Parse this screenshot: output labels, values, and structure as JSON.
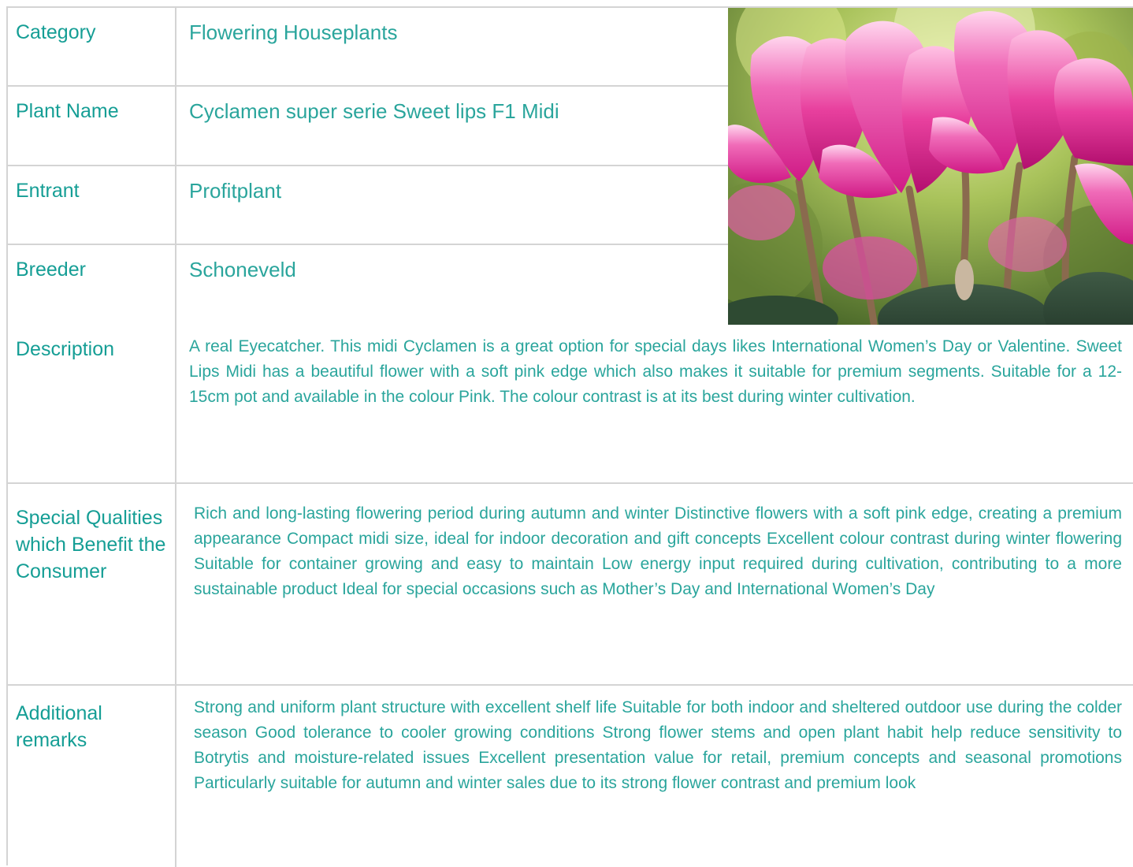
{
  "rows": {
    "category": {
      "label": "Category",
      "value": "Flowering Houseplants"
    },
    "plant_name": {
      "label": "Plant Name",
      "value": "Cyclamen super serie Sweet lips F1 Midi"
    },
    "entrant": {
      "label": "Entrant",
      "value": "Profitplant"
    },
    "breeder": {
      "label": "Breeder",
      "value": "Schoneveld"
    },
    "description": {
      "label": "Description",
      "value": "A real Eyecatcher. This midi Cyclamen is a great option for special days likes International Women’s Day or Valentine. Sweet Lips Midi has a beautiful flower with a soft pink edge which also makes it suitable for premium segments. Suitable for a 12-15cm pot and available in the colour Pink. The colour contrast is at its best during winter cultivation."
    },
    "special_qualities": {
      "label": "Special Qualities which Benefit the Consumer",
      "value": "Rich and long-lasting flowering period during autumn and winter Distinctive flowers with a soft pink edge, creating a premium appearance Compact midi size, ideal for indoor decoration and gift concepts Excellent colour contrast during winter flowering Suitable for container growing and easy to maintain Low energy input required during cultivation, contributing to a more sustainable product Ideal for special occasions such as Mother’s Day and International Women’s Day"
    },
    "additional_remarks": {
      "label": "Additional remarks",
      "value": "Strong and uniform plant structure with excellent shelf life Suitable for both indoor and sheltered outdoor use during the colder season Good tolerance to cooler growing conditions Strong flower stems and open plant habit help reduce sensitivity to Botrytis and moisture-related issues Excellent presentation value for retail, premium concepts and seasonal promotions Particularly suitable for autumn and winter sales due to its strong flower contrast and premium look"
    }
  },
  "colors": {
    "label_text": "#159e95",
    "value_text": "#2aa59c",
    "grid_line": "#d4d4d4"
  }
}
